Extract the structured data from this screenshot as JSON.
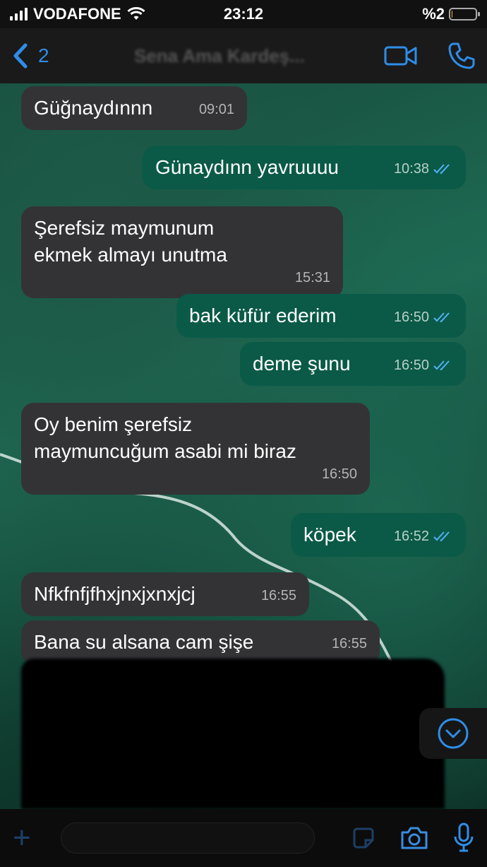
{
  "status_bar": {
    "carrier": "VODAFONE",
    "time": "23:12",
    "battery": "%2",
    "battery_level": 0.02
  },
  "header": {
    "back_count": "2",
    "contact_name": "Sena Ama Kardeş..."
  },
  "messages": [
    {
      "dir": "in",
      "text": "Güğnaydınnn",
      "time": "09:01"
    },
    {
      "dir": "out",
      "text": "Günaydınn yavruuuu",
      "time": "10:38"
    },
    {
      "dir": "in",
      "text": "Şerefsiz maymunum ekmek almayı unutma",
      "time": "15:31"
    },
    {
      "dir": "out",
      "text": "bak küfür ederim",
      "time": "16:50"
    },
    {
      "dir": "out",
      "text": "deme şunu",
      "time": "16:50"
    },
    {
      "dir": "in",
      "text": "Oy benim şerefsiz maymuncuğum asabi mi biraz",
      "time": "16:50"
    },
    {
      "dir": "out",
      "text": "köpek",
      "time": "16:52"
    },
    {
      "dir": "in",
      "text": "Nfkfnfjfhxjnxjxnxjcj",
      "time": "16:55"
    },
    {
      "dir": "in",
      "text": "Bana su alsana cam şişe",
      "time": "16:55"
    }
  ],
  "input": {
    "placeholder": ""
  },
  "colors": {
    "accent": "#2f8de8",
    "incoming_bubble": "#333335",
    "outgoing_bubble": "#0a5a47",
    "read_ticks": "#4fb3f5"
  }
}
